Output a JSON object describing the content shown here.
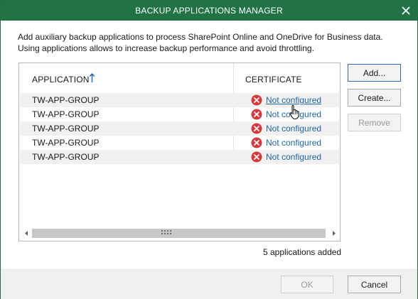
{
  "window": {
    "title": "BACKUP APPLICATIONS MANAGER",
    "accent_color": "#217346"
  },
  "intro_text": "Add auxiliary backup applications to process SharePoint Online and OneDrive for Business data. Using applications allows to increase backup performance and avoid throttling.",
  "grid": {
    "columns": {
      "application": "APPLICATION",
      "certificate": "CERTIFICATE"
    },
    "sort_icon": "arrow-up-icon",
    "status_icon": "error-x-circle-icon",
    "rows": [
      {
        "application": "TW-APP-GROUP",
        "certificate": "Not configured"
      },
      {
        "application": "TW-APP-GROUP",
        "certificate": "Not configured"
      },
      {
        "application": "TW-APP-GROUP",
        "certificate": "Not configured"
      },
      {
        "application": "TW-APP-GROUP",
        "certificate": "Not configured"
      },
      {
        "application": "TW-APP-GROUP",
        "certificate": "Not configured"
      }
    ]
  },
  "summary": "5 applications added",
  "buttons": {
    "add": "Add...",
    "create": "Create...",
    "remove": "Remove",
    "ok": "OK",
    "cancel": "Cancel"
  }
}
